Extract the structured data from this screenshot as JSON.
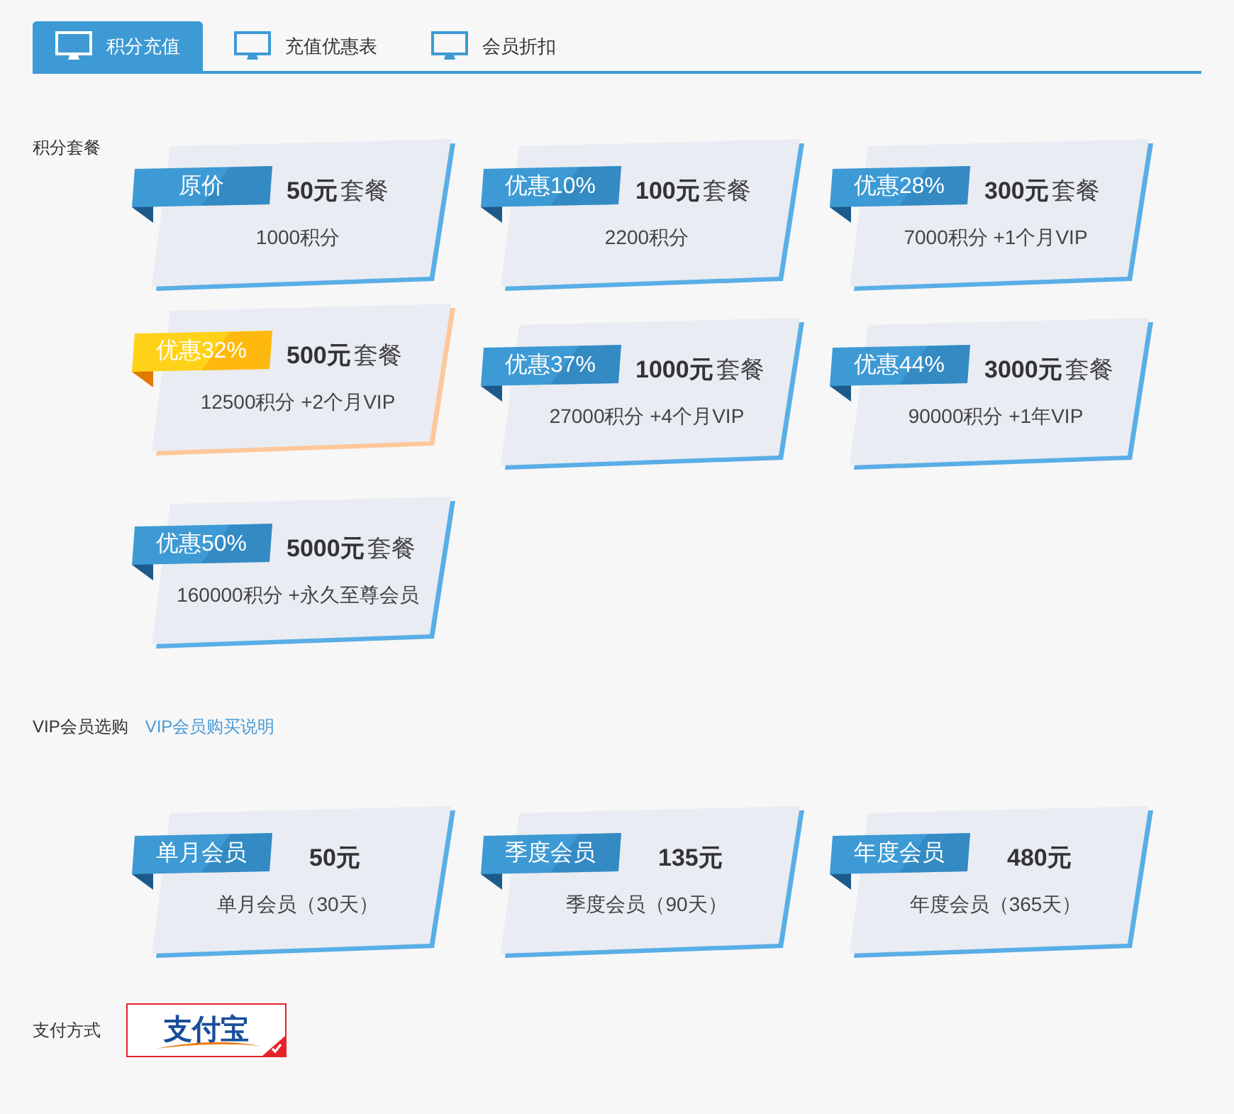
{
  "tabs": [
    {
      "label": "积分充值",
      "selected": true
    },
    {
      "label": "充值优惠表",
      "selected": false
    },
    {
      "label": "会员折扣",
      "selected": false
    }
  ],
  "points_section": {
    "label": "积分套餐",
    "packages": [
      {
        "ribbon": "原价",
        "price": "50元",
        "unit": "套餐",
        "detail": "1000积分",
        "selected": false
      },
      {
        "ribbon": "优惠10%",
        "price": "100元",
        "unit": "套餐",
        "detail": "2200积分",
        "selected": false
      },
      {
        "ribbon": "优惠28%",
        "price": "300元",
        "unit": "套餐",
        "detail": "7000积分 +1个月VIP",
        "selected": false
      },
      {
        "ribbon": "优惠32%",
        "price": "500元",
        "unit": "套餐",
        "detail": "12500积分 +2个月VIP",
        "selected": true
      },
      {
        "ribbon": "优惠37%",
        "price": "1000元",
        "unit": "套餐",
        "detail": "27000积分 +4个月VIP",
        "selected": false
      },
      {
        "ribbon": "优惠44%",
        "price": "3000元",
        "unit": "套餐",
        "detail": "90000积分 +1年VIP",
        "selected": false
      },
      {
        "ribbon": "优惠50%",
        "price": "5000元",
        "unit": "套餐",
        "detail": "160000积分 +永久至尊会员",
        "selected": false
      }
    ]
  },
  "vip_section": {
    "label": "VIP会员选购",
    "link": "VIP会员购买说明",
    "plans": [
      {
        "ribbon": "单月会员",
        "price": "50元",
        "detail": "单月会员（30天）",
        "selected": false
      },
      {
        "ribbon": "季度会员",
        "price": "135元",
        "detail": "季度会员（90天）",
        "selected": false
      },
      {
        "ribbon": "年度会员",
        "price": "480元",
        "detail": "年度会员（365天）",
        "selected": false
      }
    ]
  },
  "payment": {
    "label": "支付方式",
    "method": "支付宝",
    "selected": true
  }
}
